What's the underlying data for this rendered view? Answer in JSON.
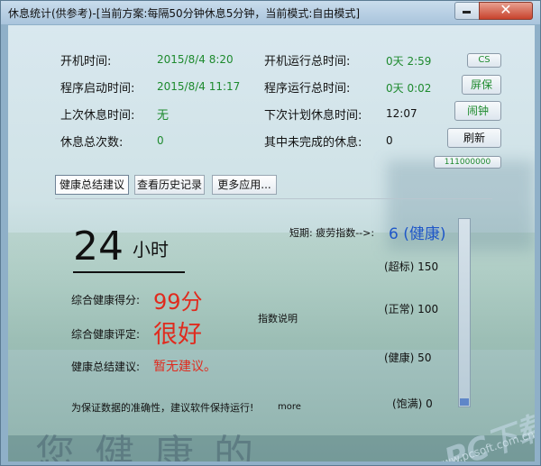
{
  "window": {
    "title": "休息统计(供参考)-[当前方案:每隔50分钟休息5分钟，当前模式:自由模式]",
    "close_glyph": "✕"
  },
  "stats": {
    "boot_time_label": "开机时间:",
    "boot_time_value": "2015/8/4 8:20",
    "app_start_label": "程序启动时间:",
    "app_start_value": "2015/8/4 11:17",
    "last_rest_label": "上次休息时间:",
    "last_rest_value": "无",
    "rest_count_label": "休息总次数:",
    "rest_count_value": "0",
    "boot_run_label": "开机运行总时间:",
    "boot_run_value": "0天 2:59",
    "app_run_label": "程序运行总时间:",
    "app_run_value": "0天 0:02",
    "next_rest_label": "下次计划休息时间:",
    "next_rest_value": "12:07",
    "unfinished_label": "其中未完成的休息:",
    "unfinished_value": "0"
  },
  "buttons": {
    "cs": "CS",
    "screen_saver": "屏保",
    "alarm": "闹钟",
    "refresh": "刷新",
    "code": "111000000"
  },
  "tabs": [
    {
      "label": "健康总结建议"
    },
    {
      "label": "查看历史记录"
    },
    {
      "label": "更多应用..."
    }
  ],
  "summary": {
    "hours_value": "24",
    "hours_unit": "小时",
    "score_label": "综合健康得分:",
    "score_value": "99分",
    "rating_label": "综合健康评定:",
    "rating_value": "很好",
    "advice_label": "健康总结建议:",
    "advice_value": "暂无建议。",
    "index_link": "指数说明",
    "footer_note": "为保证数据的准确性，建议软件保持运行!",
    "more_link": "more"
  },
  "fatigue": {
    "label": "短期: 疲劳指数-->:",
    "value": "6 (健康)",
    "scale": [
      "(超标) 150",
      "(正常) 100",
      "(健康) 50",
      "(饱满) 0"
    ],
    "level_fraction": 0.04
  },
  "watermark": {
    "logo": "PC下载网",
    "site": "www.pcsoft.com.cn"
  },
  "background": {
    "text": "您健康的"
  },
  "colors": {
    "accent_green": "#1e8a2e",
    "accent_red": "#e02b1e",
    "accent_blue": "#1f57c8"
  }
}
